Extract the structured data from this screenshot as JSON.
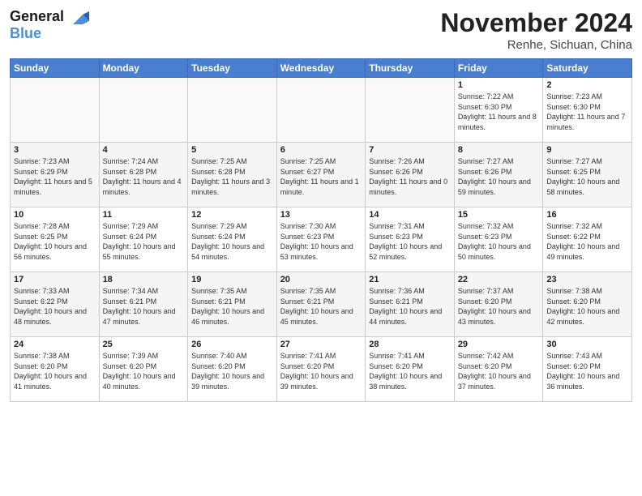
{
  "logo": {
    "line1": "General",
    "line2": "Blue"
  },
  "title": "November 2024",
  "location": "Renhe, Sichuan, China",
  "days_of_week": [
    "Sunday",
    "Monday",
    "Tuesday",
    "Wednesday",
    "Thursday",
    "Friday",
    "Saturday"
  ],
  "weeks": [
    [
      {
        "day": "",
        "info": ""
      },
      {
        "day": "",
        "info": ""
      },
      {
        "day": "",
        "info": ""
      },
      {
        "day": "",
        "info": ""
      },
      {
        "day": "",
        "info": ""
      },
      {
        "day": "1",
        "info": "Sunrise: 7:22 AM\nSunset: 6:30 PM\nDaylight: 11 hours and 8 minutes."
      },
      {
        "day": "2",
        "info": "Sunrise: 7:23 AM\nSunset: 6:30 PM\nDaylight: 11 hours and 7 minutes."
      }
    ],
    [
      {
        "day": "3",
        "info": "Sunrise: 7:23 AM\nSunset: 6:29 PM\nDaylight: 11 hours and 5 minutes."
      },
      {
        "day": "4",
        "info": "Sunrise: 7:24 AM\nSunset: 6:28 PM\nDaylight: 11 hours and 4 minutes."
      },
      {
        "day": "5",
        "info": "Sunrise: 7:25 AM\nSunset: 6:28 PM\nDaylight: 11 hours and 3 minutes."
      },
      {
        "day": "6",
        "info": "Sunrise: 7:25 AM\nSunset: 6:27 PM\nDaylight: 11 hours and 1 minute."
      },
      {
        "day": "7",
        "info": "Sunrise: 7:26 AM\nSunset: 6:26 PM\nDaylight: 11 hours and 0 minutes."
      },
      {
        "day": "8",
        "info": "Sunrise: 7:27 AM\nSunset: 6:26 PM\nDaylight: 10 hours and 59 minutes."
      },
      {
        "day": "9",
        "info": "Sunrise: 7:27 AM\nSunset: 6:25 PM\nDaylight: 10 hours and 58 minutes."
      }
    ],
    [
      {
        "day": "10",
        "info": "Sunrise: 7:28 AM\nSunset: 6:25 PM\nDaylight: 10 hours and 56 minutes."
      },
      {
        "day": "11",
        "info": "Sunrise: 7:29 AM\nSunset: 6:24 PM\nDaylight: 10 hours and 55 minutes."
      },
      {
        "day": "12",
        "info": "Sunrise: 7:29 AM\nSunset: 6:24 PM\nDaylight: 10 hours and 54 minutes."
      },
      {
        "day": "13",
        "info": "Sunrise: 7:30 AM\nSunset: 6:23 PM\nDaylight: 10 hours and 53 minutes."
      },
      {
        "day": "14",
        "info": "Sunrise: 7:31 AM\nSunset: 6:23 PM\nDaylight: 10 hours and 52 minutes."
      },
      {
        "day": "15",
        "info": "Sunrise: 7:32 AM\nSunset: 6:23 PM\nDaylight: 10 hours and 50 minutes."
      },
      {
        "day": "16",
        "info": "Sunrise: 7:32 AM\nSunset: 6:22 PM\nDaylight: 10 hours and 49 minutes."
      }
    ],
    [
      {
        "day": "17",
        "info": "Sunrise: 7:33 AM\nSunset: 6:22 PM\nDaylight: 10 hours and 48 minutes."
      },
      {
        "day": "18",
        "info": "Sunrise: 7:34 AM\nSunset: 6:21 PM\nDaylight: 10 hours and 47 minutes."
      },
      {
        "day": "19",
        "info": "Sunrise: 7:35 AM\nSunset: 6:21 PM\nDaylight: 10 hours and 46 minutes."
      },
      {
        "day": "20",
        "info": "Sunrise: 7:35 AM\nSunset: 6:21 PM\nDaylight: 10 hours and 45 minutes."
      },
      {
        "day": "21",
        "info": "Sunrise: 7:36 AM\nSunset: 6:21 PM\nDaylight: 10 hours and 44 minutes."
      },
      {
        "day": "22",
        "info": "Sunrise: 7:37 AM\nSunset: 6:20 PM\nDaylight: 10 hours and 43 minutes."
      },
      {
        "day": "23",
        "info": "Sunrise: 7:38 AM\nSunset: 6:20 PM\nDaylight: 10 hours and 42 minutes."
      }
    ],
    [
      {
        "day": "24",
        "info": "Sunrise: 7:38 AM\nSunset: 6:20 PM\nDaylight: 10 hours and 41 minutes."
      },
      {
        "day": "25",
        "info": "Sunrise: 7:39 AM\nSunset: 6:20 PM\nDaylight: 10 hours and 40 minutes."
      },
      {
        "day": "26",
        "info": "Sunrise: 7:40 AM\nSunset: 6:20 PM\nDaylight: 10 hours and 39 minutes."
      },
      {
        "day": "27",
        "info": "Sunrise: 7:41 AM\nSunset: 6:20 PM\nDaylight: 10 hours and 39 minutes."
      },
      {
        "day": "28",
        "info": "Sunrise: 7:41 AM\nSunset: 6:20 PM\nDaylight: 10 hours and 38 minutes."
      },
      {
        "day": "29",
        "info": "Sunrise: 7:42 AM\nSunset: 6:20 PM\nDaylight: 10 hours and 37 minutes."
      },
      {
        "day": "30",
        "info": "Sunrise: 7:43 AM\nSunset: 6:20 PM\nDaylight: 10 hours and 36 minutes."
      }
    ]
  ]
}
